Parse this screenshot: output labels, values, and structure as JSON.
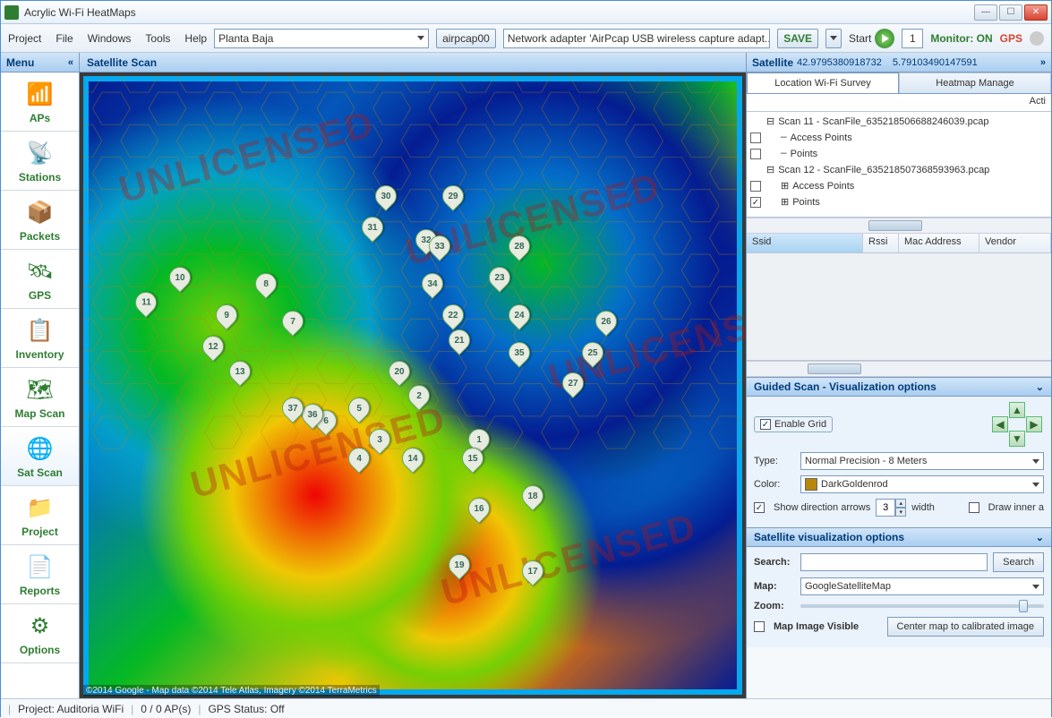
{
  "app": {
    "title": "Acrylic Wi-Fi HeatMaps"
  },
  "menus": {
    "project": "Project",
    "file": "File",
    "windows": "Windows",
    "tools": "Tools",
    "help": "Help"
  },
  "toolbar": {
    "plan": "Planta Baja",
    "adapter_btn": "airpcap00",
    "adapter_desc": "Network adapter 'AirPcap USB wireless capture adapt...",
    "save": "SAVE",
    "start": "Start",
    "start_count": "1",
    "monitor": "Monitor: ON",
    "gps": "GPS"
  },
  "sidebar": {
    "title": "Menu",
    "items": [
      {
        "label": "APs"
      },
      {
        "label": "Stations"
      },
      {
        "label": "Packets"
      },
      {
        "label": "GPS"
      },
      {
        "label": "Inventory"
      },
      {
        "label": "Map Scan"
      },
      {
        "label": "Sat Scan"
      },
      {
        "label": "Project"
      },
      {
        "label": "Reports"
      },
      {
        "label": "Options"
      }
    ]
  },
  "main": {
    "title": "Satellite Scan",
    "watermark": "UNLICENSED",
    "attribution": "©2014 Google - Map data ©2014 Tele Atlas, Imagery ©2014 TerraMetrics",
    "markers": [
      {
        "n": "1",
        "x": 60,
        "y": 61
      },
      {
        "n": "2",
        "x": 51,
        "y": 54
      },
      {
        "n": "3",
        "x": 45,
        "y": 61
      },
      {
        "n": "4",
        "x": 42,
        "y": 64
      },
      {
        "n": "5",
        "x": 42,
        "y": 56
      },
      {
        "n": "6",
        "x": 37,
        "y": 58
      },
      {
        "n": "7",
        "x": 32,
        "y": 42
      },
      {
        "n": "8",
        "x": 28,
        "y": 36
      },
      {
        "n": "9",
        "x": 22,
        "y": 41
      },
      {
        "n": "10",
        "x": 15,
        "y": 35
      },
      {
        "n": "11",
        "x": 10,
        "y": 39
      },
      {
        "n": "12",
        "x": 20,
        "y": 46
      },
      {
        "n": "13",
        "x": 24,
        "y": 50
      },
      {
        "n": "14",
        "x": 50,
        "y": 64
      },
      {
        "n": "15",
        "x": 59,
        "y": 64
      },
      {
        "n": "16",
        "x": 60,
        "y": 72
      },
      {
        "n": "17",
        "x": 68,
        "y": 82
      },
      {
        "n": "18",
        "x": 68,
        "y": 70
      },
      {
        "n": "19",
        "x": 57,
        "y": 81
      },
      {
        "n": "20",
        "x": 48,
        "y": 50
      },
      {
        "n": "21",
        "x": 57,
        "y": 45
      },
      {
        "n": "22",
        "x": 56,
        "y": 41
      },
      {
        "n": "23",
        "x": 63,
        "y": 35
      },
      {
        "n": "24",
        "x": 66,
        "y": 41
      },
      {
        "n": "25",
        "x": 77,
        "y": 47
      },
      {
        "n": "26",
        "x": 79,
        "y": 42
      },
      {
        "n": "27",
        "x": 74,
        "y": 52
      },
      {
        "n": "28",
        "x": 66,
        "y": 30
      },
      {
        "n": "29",
        "x": 56,
        "y": 22
      },
      {
        "n": "30",
        "x": 46,
        "y": 22
      },
      {
        "n": "31",
        "x": 44,
        "y": 27
      },
      {
        "n": "32",
        "x": 52,
        "y": 29
      },
      {
        "n": "33",
        "x": 54,
        "y": 30
      },
      {
        "n": "34",
        "x": 53,
        "y": 36
      },
      {
        "n": "35",
        "x": 66,
        "y": 47
      },
      {
        "n": "36",
        "x": 35,
        "y": 57
      },
      {
        "n": "37",
        "x": 32,
        "y": 56
      }
    ]
  },
  "right": {
    "title": "Satellite",
    "lat": "42.9795380918732",
    "lon": "5.79103490147591",
    "tabs": {
      "survey": "Location Wi-Fi Survey",
      "heatmap": "Heatmap Manage"
    },
    "action_header": "Acti",
    "tree": [
      {
        "type": "scan",
        "label": "Scan 11 - ScanFile_635218506688246039.pcap"
      },
      {
        "type": "child",
        "checked": false,
        "label": "Access Points"
      },
      {
        "type": "child",
        "checked": false,
        "label": "Points"
      },
      {
        "type": "scan",
        "label": "Scan 12 - ScanFile_635218507368593963.pcap"
      },
      {
        "type": "child",
        "checked": false,
        "label": "Access Points",
        "plus": true
      },
      {
        "type": "child",
        "checked": true,
        "label": "Points",
        "plus": true
      }
    ],
    "ssid_cols": {
      "ssid": "Ssid",
      "rssi": "Rssi",
      "mac": "Mac Address",
      "vendor": "Vendor"
    },
    "guided": {
      "title": "Guided Scan - Visualization options",
      "enable_grid": "Enable Grid",
      "type_label": "Type:",
      "type_value": "Normal Precision - 8 Meters",
      "color_label": "Color:",
      "color_value": "DarkGoldenrod",
      "dir_arrows": "Show direction arrows",
      "dir_value": "3",
      "width_label": "width",
      "draw_inner": "Draw inner a"
    },
    "satopts": {
      "title": "Satellite visualization options",
      "search_label": "Search:",
      "search_btn": "Search",
      "map_label": "Map:",
      "map_value": "GoogleSatelliteMap",
      "zoom_label": "Zoom:",
      "map_visible": "Map Image Visible",
      "center_btn": "Center map to calibrated image"
    }
  },
  "status": {
    "project": "Project: Auditoria WiFi",
    "aps": "0 / 0 AP(s)",
    "gps": "GPS Status: Off"
  }
}
